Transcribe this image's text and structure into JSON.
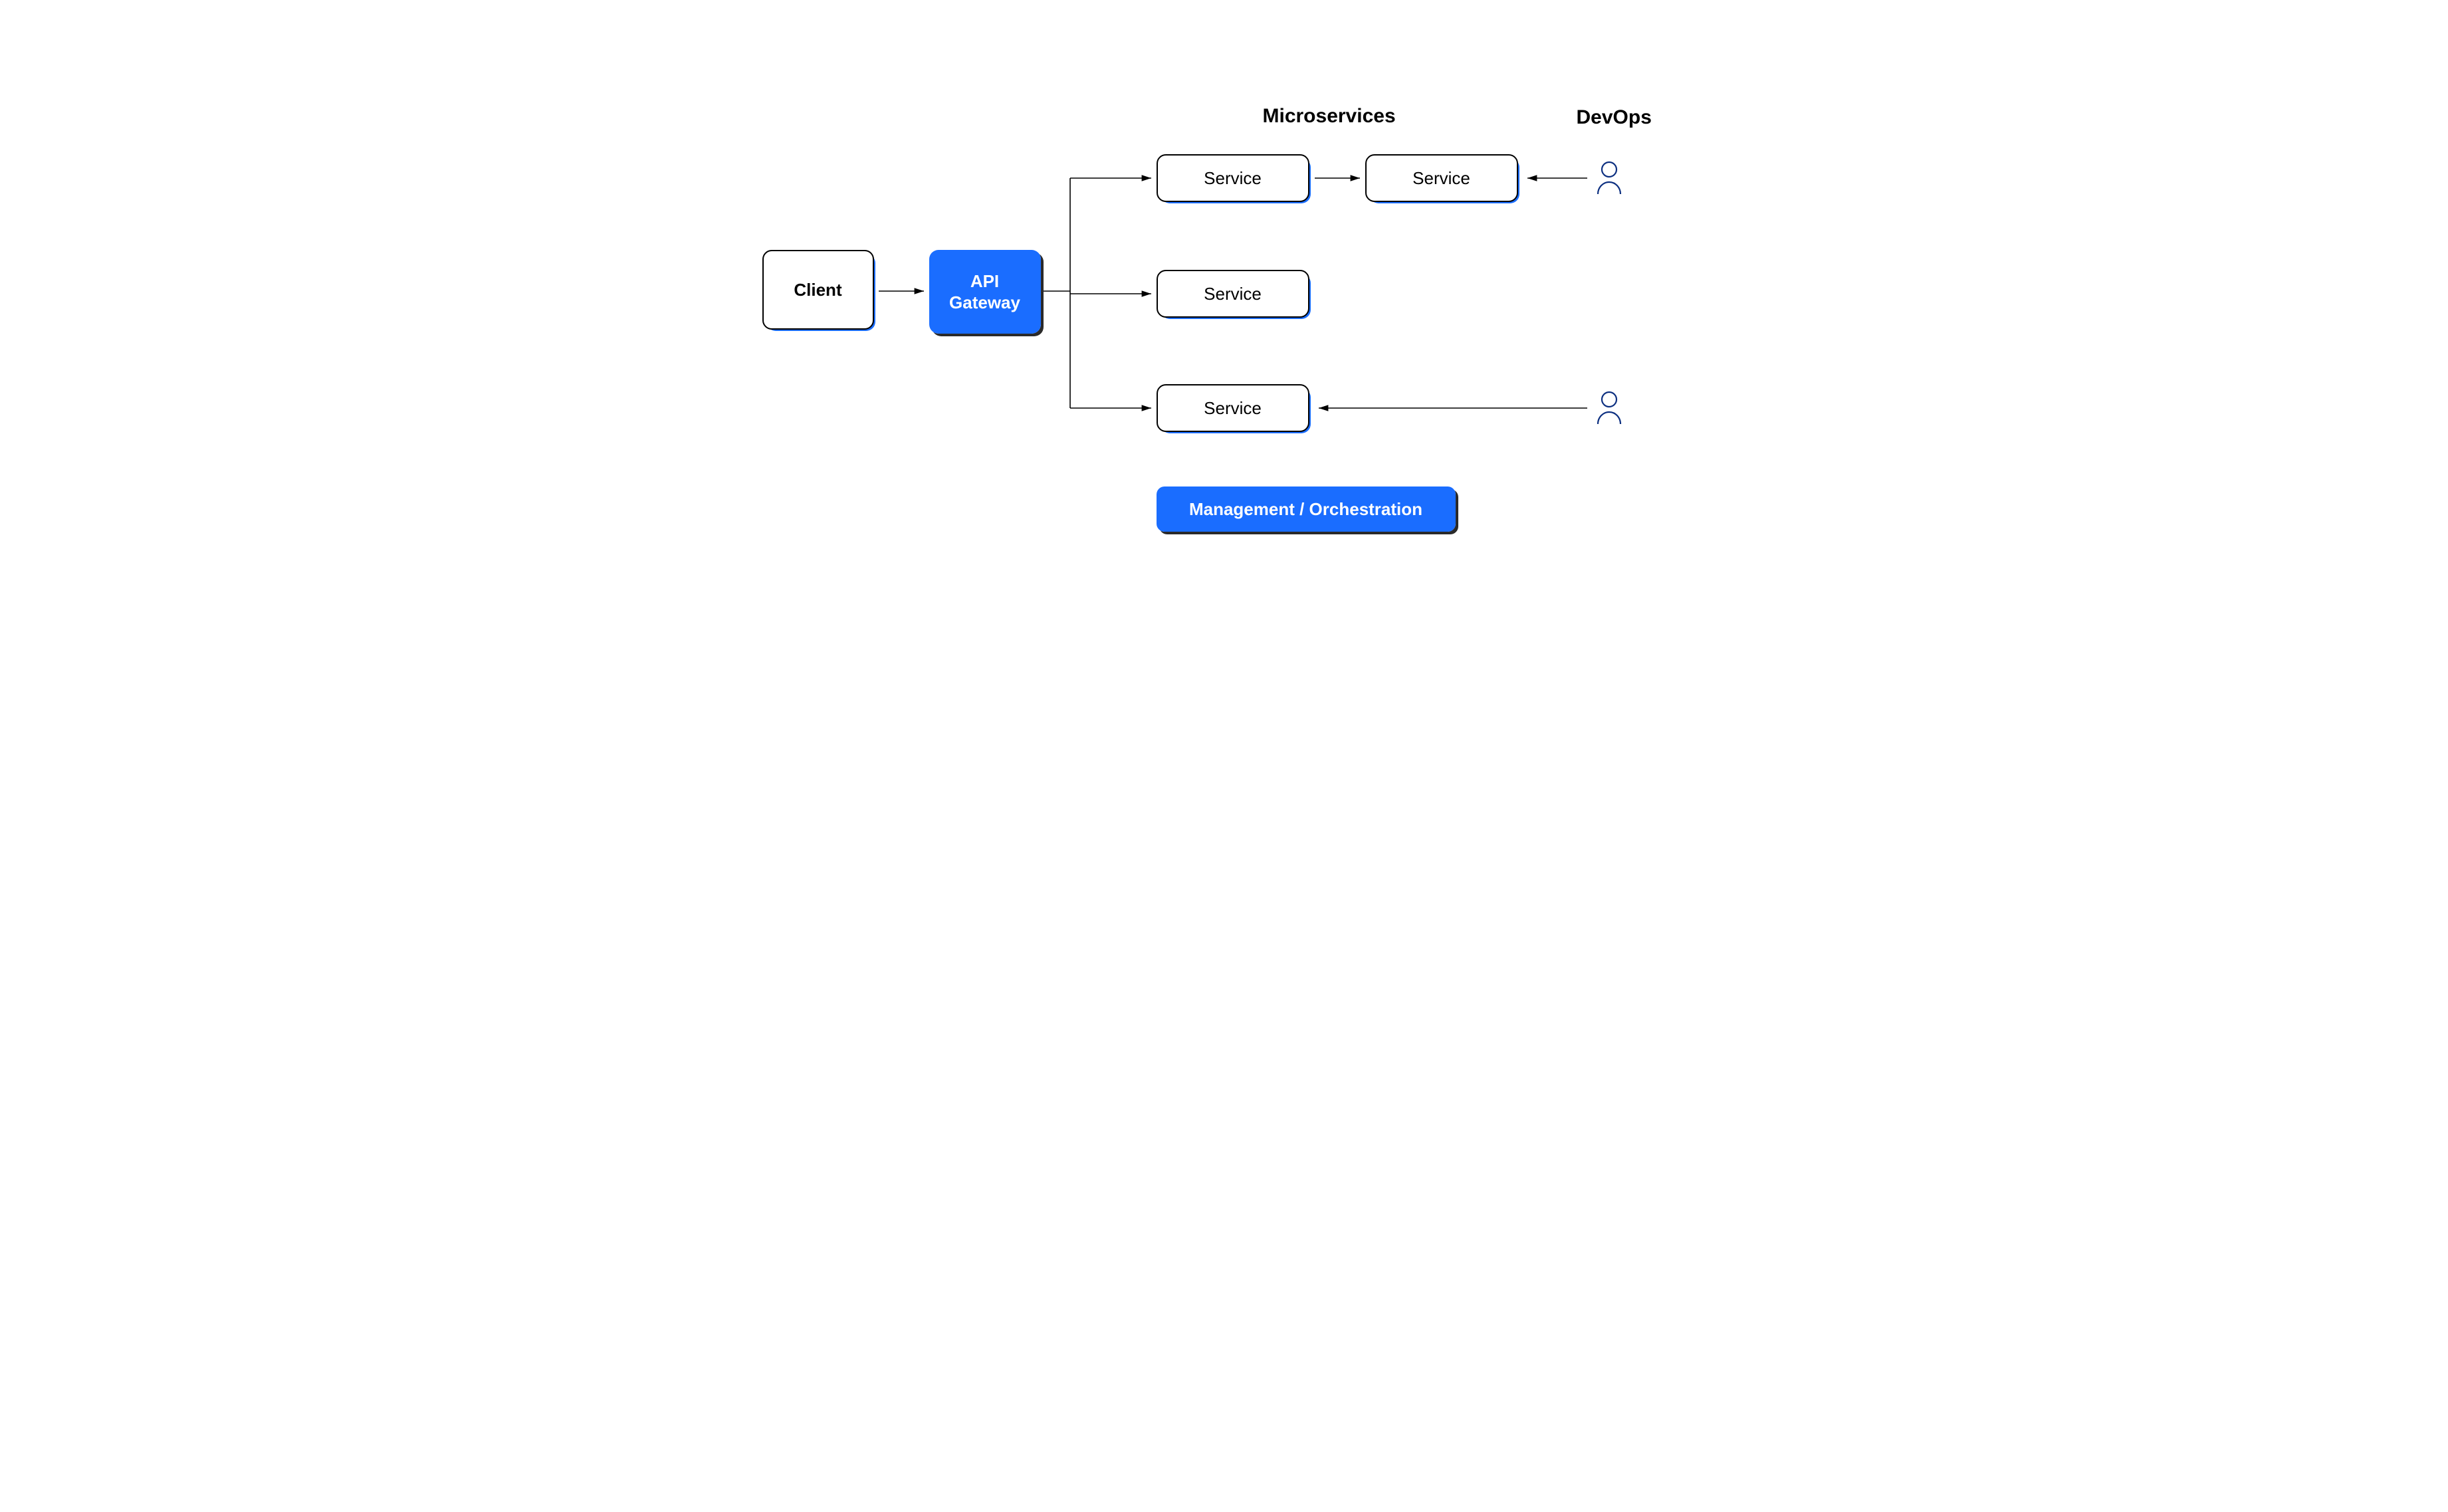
{
  "headings": {
    "microservices": "Microservices",
    "devops": "DevOps"
  },
  "nodes": {
    "client": "Client",
    "gateway": "API\nGateway",
    "service1": "Service",
    "service2": "Service",
    "service3": "Service",
    "service4": "Service",
    "orchestration": "Management / Orchestration"
  },
  "icons": {
    "devops_person1": "person-icon",
    "devops_person2": "person-icon"
  },
  "colors": {
    "accent": "#1a6dff",
    "stroke": "#000000"
  }
}
